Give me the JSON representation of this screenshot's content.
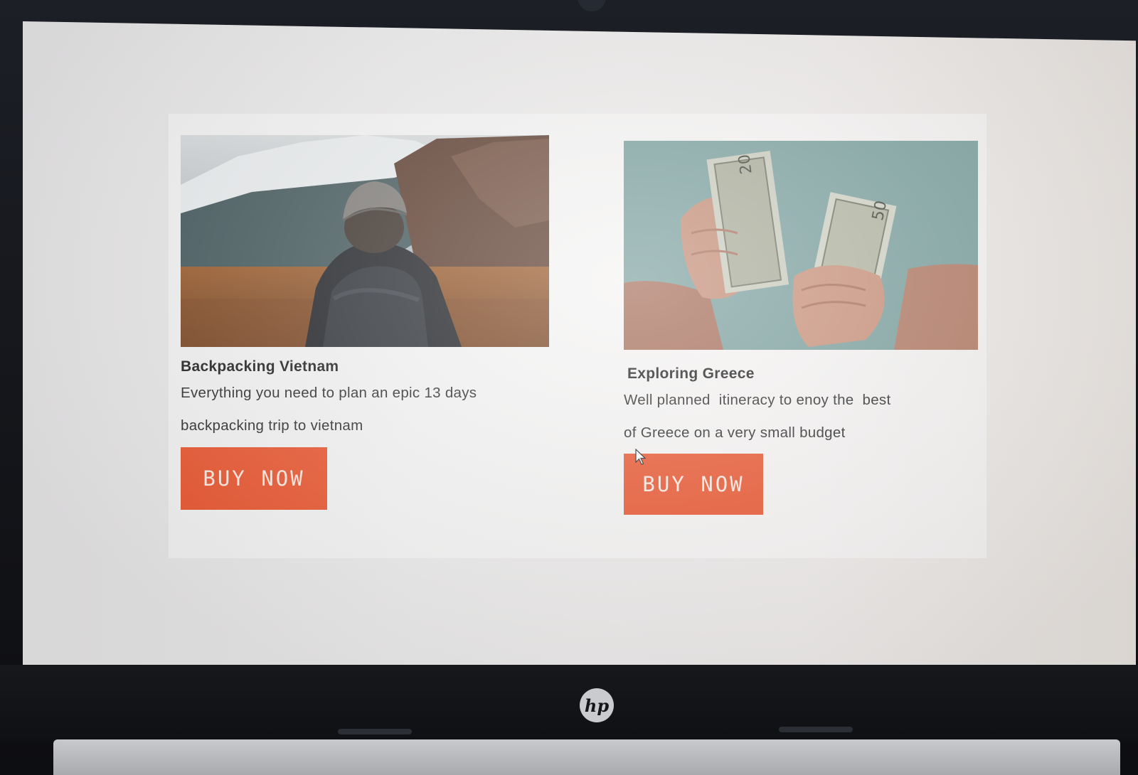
{
  "cards": [
    {
      "title": "Backpacking Vietnam",
      "desc_line1": "Everything you need to plan an epic 13 days",
      "desc_line2": "backpacking trip to vietnam",
      "button": "BUY NOW"
    },
    {
      "title": "Exploring Greece",
      "desc_line1": "Well planned  itineracy to enoy the  best",
      "desc_line2": "of Greece on a very small budget",
      "button": "BUY NOW"
    }
  ],
  "colors": {
    "button_bg": "#e9542d",
    "button_text": "#fbe9e1",
    "title_text": "#1c1c1c"
  },
  "icons": [
    "hiker-photo",
    "money-photo",
    "mouse-cursor-icon",
    "hp-logo"
  ]
}
